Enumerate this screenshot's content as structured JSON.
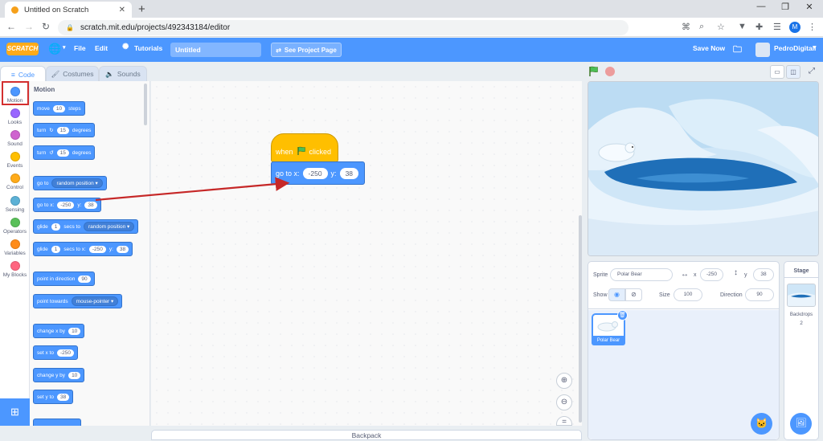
{
  "browser": {
    "tab_title": "Untitled on Scratch",
    "url": "scratch.mit.edu/projects/492343184/editor",
    "profile_initial": "M"
  },
  "menu": {
    "logo": "SCRATCH",
    "file": "File",
    "edit": "Edit",
    "tutorials": "Tutorials",
    "project_title": "Untitled",
    "see_project_page": "See Project Page",
    "save_now": "Save Now",
    "username": "PedroDigitall"
  },
  "editor_tabs": {
    "code": "Code",
    "costumes": "Costumes",
    "sounds": "Sounds"
  },
  "categories": [
    {
      "label": "Motion",
      "color": "#4c97ff"
    },
    {
      "label": "Looks",
      "color": "#9966ff"
    },
    {
      "label": "Sound",
      "color": "#cf63cf"
    },
    {
      "label": "Events",
      "color": "#ffbf00"
    },
    {
      "label": "Control",
      "color": "#ffab19"
    },
    {
      "label": "Sensing",
      "color": "#5cb1d6"
    },
    {
      "label": "Operators",
      "color": "#59c059"
    },
    {
      "label": "Variables",
      "color": "#ff8c1a"
    },
    {
      "label": "My Blocks",
      "color": "#ff6680"
    }
  ],
  "palette": {
    "heading": "Motion",
    "move": {
      "a": "move",
      "v": "10",
      "b": "steps"
    },
    "turn_right": {
      "a": "turn",
      "v": "15",
      "b": "degrees"
    },
    "turn_left": {
      "a": "turn",
      "v": "15",
      "b": "degrees"
    },
    "goto_menu": {
      "a": "go to",
      "menu": "random position"
    },
    "goto_xy": {
      "a": "go to x:",
      "x": "-250",
      "b": "y:",
      "y": "38"
    },
    "glide_menu": {
      "a": "glide",
      "v": "1",
      "b": "secs to",
      "menu": "random position"
    },
    "glide_xy": {
      "a": "glide",
      "v": "1",
      "b": "secs to x:",
      "x": "-250",
      "c": "y:",
      "y": "38"
    },
    "point_dir": {
      "a": "point in direction",
      "v": "90"
    },
    "point_towards": {
      "a": "point towards",
      "menu": "mouse-pointer"
    },
    "change_x": {
      "a": "change x by",
      "v": "10"
    },
    "set_x": {
      "a": "set x to",
      "v": "-250"
    },
    "change_y": {
      "a": "change y by",
      "v": "10"
    },
    "set_y": {
      "a": "set y to",
      "v": "38"
    }
  },
  "script": {
    "hat_a": "when",
    "hat_b": "clicked",
    "goto_a": "go to x:",
    "goto_x": "-250",
    "goto_b": "y:",
    "goto_y": "38"
  },
  "backpack": "Backpack",
  "sprite_info": {
    "sprite_label": "Sprite",
    "sprite_name": "Polar Bear",
    "x_label": "x",
    "x_value": "-250",
    "y_label": "y",
    "y_value": "38",
    "show_label": "Show",
    "size_label": "Size",
    "size_value": "100",
    "direction_label": "Direction",
    "direction_value": "90"
  },
  "sprites": [
    {
      "name": "Polar Bear"
    }
  ],
  "stage_panel": {
    "title": "Stage",
    "backdrops_label": "Backdrops",
    "backdrops_count": "2"
  }
}
